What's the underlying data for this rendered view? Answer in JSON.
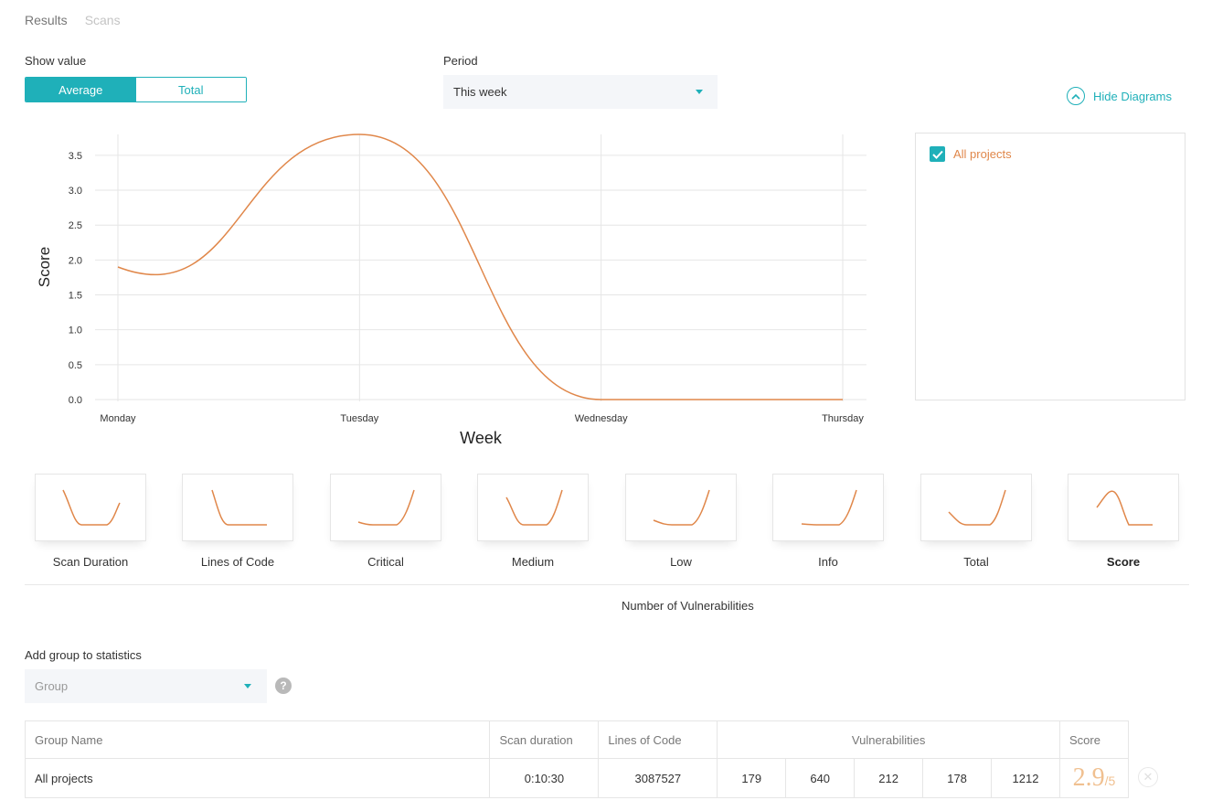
{
  "tabs": [
    {
      "label": "Results",
      "active": true
    },
    {
      "label": "Scans",
      "active": false
    }
  ],
  "show_value": {
    "label": "Show value",
    "options": [
      "Average",
      "Total"
    ],
    "selected": "Average"
  },
  "period": {
    "label": "Period",
    "value": "This week"
  },
  "hide_diagrams_label": "Hide Diagrams",
  "projects_panel": {
    "items": [
      {
        "label": "All projects",
        "checked": true
      }
    ]
  },
  "chart_data": {
    "type": "line",
    "x": [
      "Monday",
      "Tuesday",
      "Wednesday",
      "Thursday"
    ],
    "series": [
      {
        "values": [
          1.9,
          3.8,
          0.0,
          0.0
        ],
        "color": "#e0874a"
      }
    ],
    "yticks": [
      "0.0",
      "0.5",
      "1.0",
      "1.5",
      "2.0",
      "2.5",
      "3.0",
      "3.5"
    ],
    "ylim": [
      0,
      3.8
    ],
    "xlabel": "Week",
    "ylabel": "Score",
    "grid": true,
    "smooth": true
  },
  "metric_thumbnails": [
    {
      "label": "Scan Duration",
      "selected": false
    },
    {
      "label": "Lines of Code",
      "selected": false
    },
    {
      "label": "Critical",
      "selected": false
    },
    {
      "label": "Medium",
      "selected": false
    },
    {
      "label": "Low",
      "selected": false
    },
    {
      "label": "Info",
      "selected": false
    },
    {
      "label": "Total",
      "selected": false
    },
    {
      "label": "Score",
      "selected": true
    }
  ],
  "vulnerabilities_caption": "Number of Vulnerabilities",
  "add_group": {
    "label": "Add group to statistics",
    "placeholder": "Group",
    "help": "?"
  },
  "stats_table": {
    "headers": {
      "group_name": "Group Name",
      "scan_duration": "Scan duration",
      "lines_of_code": "Lines of Code",
      "vulnerabilities": "Vulnerabilities",
      "score": "Score"
    },
    "rows": [
      {
        "group_name": "All projects",
        "scan_duration": "0:10:30",
        "lines_of_code": "3087527",
        "critical": "179",
        "medium": "640",
        "low": "212",
        "info": "178",
        "total": "1212",
        "score": "2.9",
        "score_max": "/5"
      }
    ]
  },
  "colors": {
    "accent": "#1fb0b9",
    "line": "#e0874a"
  }
}
